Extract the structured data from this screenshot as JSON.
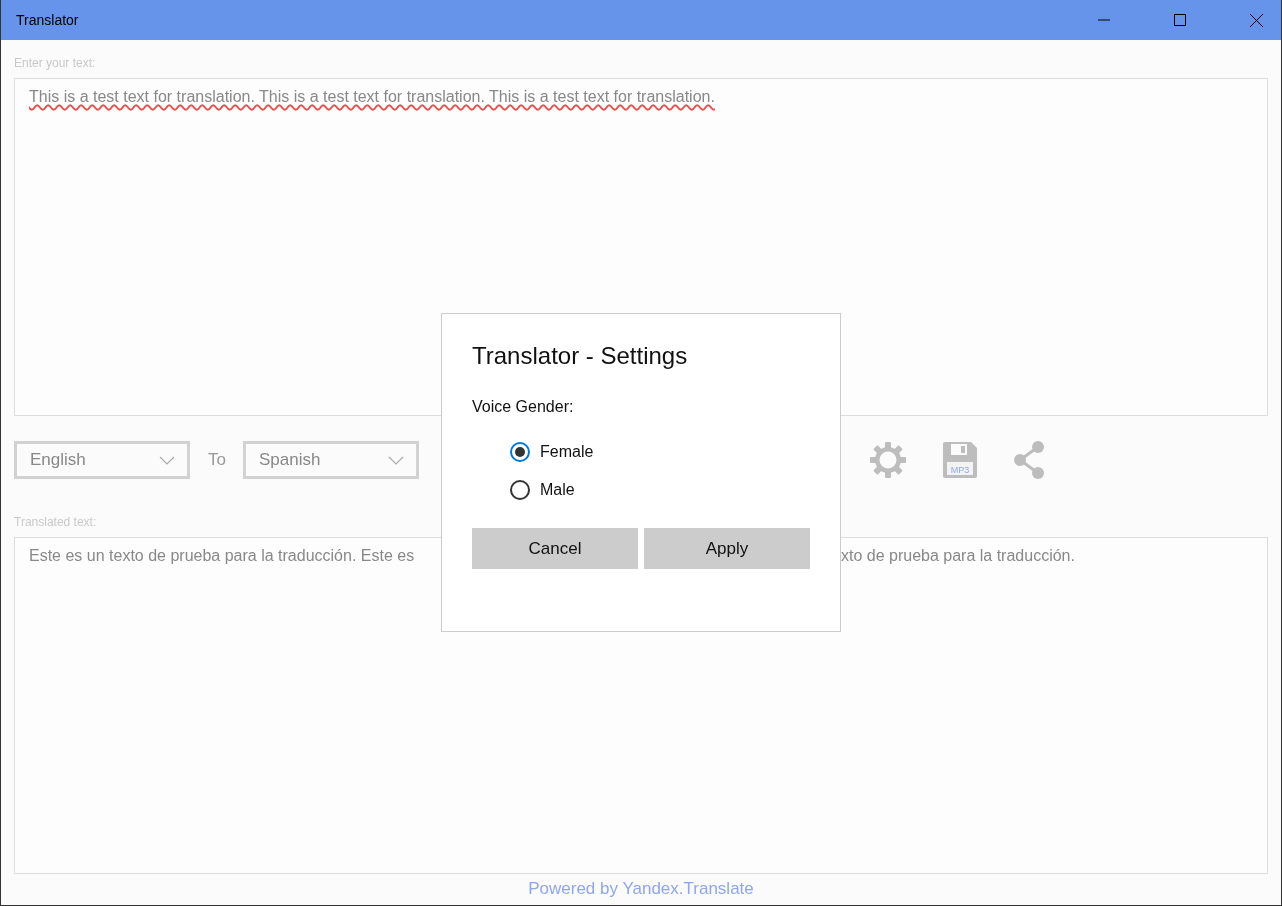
{
  "window": {
    "title": "Translator"
  },
  "input": {
    "label": "Enter your text:",
    "value": "This is a test text for translation. This is a test text for translation. This is a test text for translation.",
    "spell_errors": true
  },
  "languages": {
    "from": "English",
    "to_label": "To",
    "to": "Spanish"
  },
  "toolbar": {
    "mp3_label": "MP3"
  },
  "output": {
    "label": "Translated text:",
    "visible_fragments": [
      "Este es un texto de prueba para la traducción. Este es",
      "xto de prueba para la traducción."
    ]
  },
  "footer": {
    "link": "Powered by Yandex.Translate"
  },
  "dialog": {
    "title": "Translator - Settings",
    "group_label": "Voice Gender:",
    "options": [
      {
        "label": "Female",
        "selected": true
      },
      {
        "label": "Male",
        "selected": false
      }
    ],
    "buttons": [
      "Cancel",
      "Apply"
    ]
  }
}
